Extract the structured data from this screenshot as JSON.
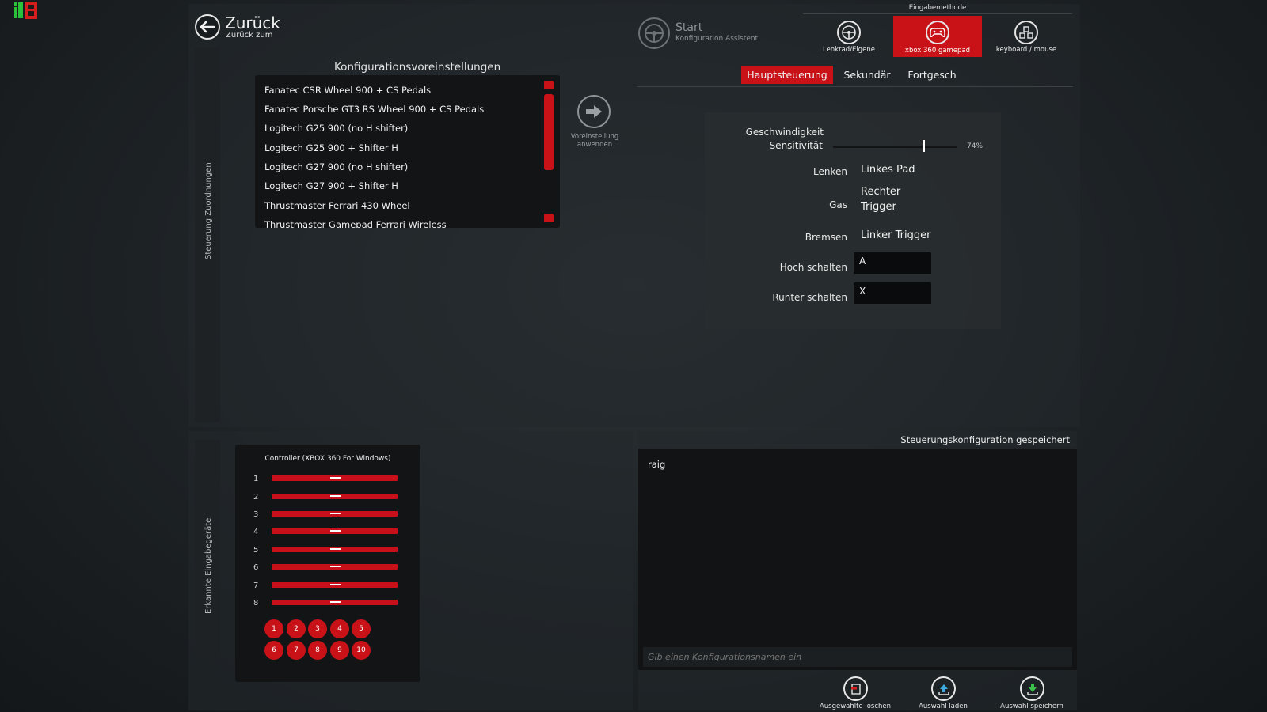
{
  "logo_text": "iB",
  "back": {
    "title": "Zurück",
    "subtitle": "Zurück zum"
  },
  "sidebar_top_label": "Steuerung Zuordnungen",
  "sidebar_bottom_label": "Erkannte Eingabegeräte",
  "presets": {
    "title": "Konfigurationsvoreinstellungen",
    "items": [
      "Fanatec CSR Wheel 900 + CS Pedals",
      "Fanatec Porsche GT3 RS Wheel 900 + CS Pedals",
      "Logitech G25 900 (no H shifter)",
      "Logitech G25 900 + Shifter H",
      "Logitech G27 900 (no H shifter)",
      "Logitech G27 900 + Shifter H",
      "Thrustmaster Ferrari 430 Wheel",
      "Thrustmaster Gamepad Ferrari Wireless"
    ],
    "apply_label_line1": "Voreinstellung",
    "apply_label_line2": "anwenden"
  },
  "start": {
    "title": "Start",
    "subtitle": "Konfiguration Assistent"
  },
  "input_method": {
    "label": "Eingabemethode",
    "options": [
      {
        "label": "Lenkrad/Eigene",
        "icon": "steering-wheel-icon",
        "active": false
      },
      {
        "label": "xbox 360 gamepad",
        "icon": "gamepad-icon",
        "active": true
      },
      {
        "label": "keyboard / mouse",
        "icon": "keyboard-mouse-icon",
        "active": false
      }
    ]
  },
  "tabs": [
    {
      "label": "Hauptsteuerung",
      "active": true
    },
    {
      "label": "Sekundär",
      "active": false
    },
    {
      "label": "Fortgesch",
      "active": false
    }
  ],
  "controls": {
    "speed_sensitivity_label_line1": "Geschwindigkeit",
    "speed_sensitivity_label_line2": "Sensitivität",
    "speed_sensitivity_value": 0.74,
    "speed_sensitivity_text": "74%",
    "steering_label": "Lenken",
    "steering_value": "Linkes Pad",
    "gas_label": "Gas",
    "gas_value_line1": "Rechter",
    "gas_value_line2": "Trigger",
    "brake_label": "Bremsen",
    "brake_value": "Linker Trigger",
    "shift_up_label": "Hoch schalten",
    "shift_up_value": "A",
    "shift_down_label": "Runter schalten",
    "shift_down_value": "X"
  },
  "device": {
    "title": "Controller (XBOX 360 For Windows)",
    "axes": [
      "1",
      "2",
      "3",
      "4",
      "5",
      "6",
      "7",
      "8"
    ],
    "buttons": [
      "1",
      "2",
      "3",
      "4",
      "5",
      "6",
      "7",
      "8",
      "9",
      "10"
    ]
  },
  "config_save": {
    "status": "Steuerungskonfiguration gespeichert",
    "saved_items": [
      "raig"
    ],
    "name_placeholder": "Gib einen Konfigurationsnamen ein",
    "actions": [
      {
        "label": "Ausgewählte löschen",
        "icon": "delete-icon"
      },
      {
        "label": "Auswahl laden",
        "icon": "load-icon"
      },
      {
        "label": "Auswahl speichern",
        "icon": "save-icon"
      }
    ]
  },
  "colors": {
    "accent": "#c81218",
    "panel_dark": "#121416"
  }
}
